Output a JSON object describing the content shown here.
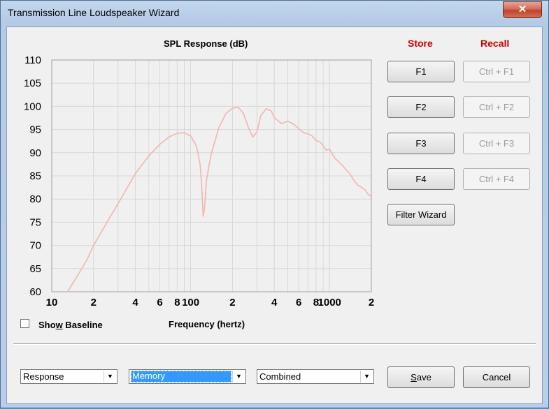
{
  "window": {
    "title": "Transmission Line Loudspeaker Wizard",
    "close_glyph": "✕"
  },
  "chart_title": "SPL Response (dB)",
  "xlabel": "Frequency (hertz)",
  "store_label": "Store",
  "recall_label": "Recall",
  "store_buttons": [
    "F1",
    "F2",
    "F3",
    "F4"
  ],
  "recall_buttons": [
    "Ctrl + F1",
    "Ctrl + F2",
    "Ctrl + F3",
    "Ctrl + F4"
  ],
  "filter_wizard_label": "Filter Wizard",
  "show_baseline": {
    "label_pre": "Sho",
    "label_key": "w",
    "label_post": " Baseline",
    "checked": false
  },
  "dropdowns": {
    "view": "Response",
    "source": "Memory",
    "mode": "Combined"
  },
  "save_label_key": "S",
  "save_label_rest": "ave",
  "cancel_label": "Cancel",
  "chart_data": {
    "type": "line",
    "title": "SPL Response (dB)",
    "xlabel": "Frequency (hertz)",
    "ylabel": "",
    "xscale": "log",
    "xlim": [
      10,
      2000
    ],
    "ylim": [
      60,
      110
    ],
    "yticks": [
      60,
      65,
      70,
      75,
      80,
      85,
      90,
      95,
      100,
      105,
      110
    ],
    "xtick_labels": [
      {
        "x": 10,
        "label": "10"
      },
      {
        "x": 20,
        "label": "2"
      },
      {
        "x": 40,
        "label": "4"
      },
      {
        "x": 60,
        "label": "6"
      },
      {
        "x": 80,
        "label": "8"
      },
      {
        "x": 100,
        "label": "100"
      },
      {
        "x": 200,
        "label": "2"
      },
      {
        "x": 400,
        "label": "4"
      },
      {
        "x": 600,
        "label": "6"
      },
      {
        "x": 800,
        "label": "8"
      },
      {
        "x": 1000,
        "label": "1000"
      },
      {
        "x": 2000,
        "label": "2"
      }
    ],
    "grid": true,
    "line_color": "#f2b5b0",
    "series": [
      {
        "x": [
          13,
          15,
          18,
          20,
          25,
          30,
          35,
          40,
          45,
          50,
          60,
          70,
          80,
          90,
          100,
          110,
          117,
          120,
          123,
          126,
          130,
          140,
          160,
          180,
          200,
          220,
          240,
          260,
          280,
          300,
          320,
          350,
          380,
          400,
          450,
          500,
          550,
          600,
          650,
          700,
          750,
          800,
          850,
          900,
          950,
          1000,
          1050,
          1100,
          1200,
          1300,
          1400,
          1500,
          1600,
          1700,
          1800,
          1900,
          2000
        ],
        "y": [
          60,
          63,
          67,
          70,
          75,
          79,
          82.5,
          85.5,
          87.5,
          89.3,
          91.8,
          93.4,
          94.2,
          94.3,
          93.6,
          91.5,
          87.5,
          83,
          76.2,
          78,
          84,
          89.5,
          95.5,
          98.5,
          99.6,
          99.8,
          98.5,
          95.5,
          93.4,
          94.5,
          98,
          99.5,
          99,
          97.6,
          96.3,
          96.8,
          96.2,
          95.2,
          94.3,
          94.1,
          93.6,
          92.6,
          92.4,
          91.5,
          90.5,
          90.8,
          89.6,
          88.7,
          87.7,
          86.5,
          85.5,
          84,
          83,
          82.5,
          82,
          81,
          80.5
        ]
      }
    ]
  }
}
